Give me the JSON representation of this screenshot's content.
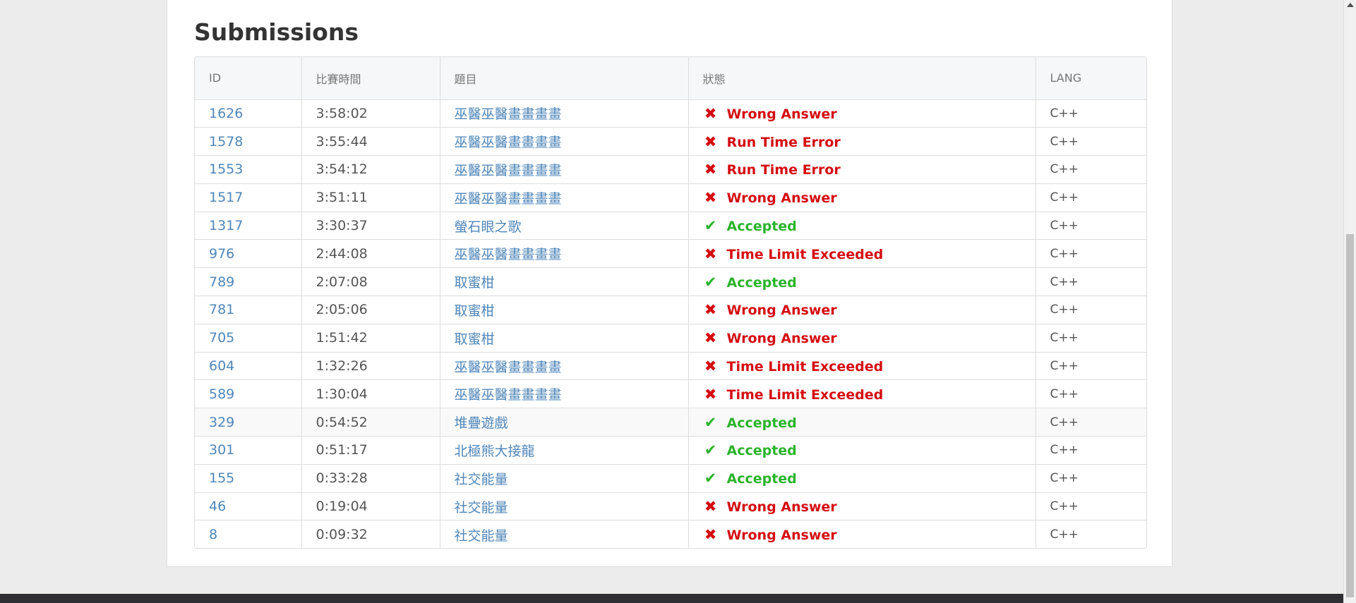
{
  "section_title": "Submissions",
  "table": {
    "headers": {
      "id": "ID",
      "time": "比賽時間",
      "problem": "題目",
      "status": "狀態",
      "lang": "LANG"
    },
    "rows": [
      {
        "id": "1626",
        "time": "3:58:02",
        "problem": "巫醫巫醫畫畫畫畫",
        "status": "Wrong Answer",
        "result": "bad",
        "lang": "C++"
      },
      {
        "id": "1578",
        "time": "3:55:44",
        "problem": "巫醫巫醫畫畫畫畫",
        "status": "Run Time Error",
        "result": "bad",
        "lang": "C++"
      },
      {
        "id": "1553",
        "time": "3:54:12",
        "problem": "巫醫巫醫畫畫畫畫",
        "status": "Run Time Error",
        "result": "bad",
        "lang": "C++"
      },
      {
        "id": "1517",
        "time": "3:51:11",
        "problem": "巫醫巫醫畫畫畫畫",
        "status": "Wrong Answer",
        "result": "bad",
        "lang": "C++"
      },
      {
        "id": "1317",
        "time": "3:30:37",
        "problem": "螢石眼之歌",
        "status": "Accepted",
        "result": "good",
        "lang": "C++"
      },
      {
        "id": "976",
        "time": "2:44:08",
        "problem": "巫醫巫醫畫畫畫畫",
        "status": "Time Limit Exceeded",
        "result": "bad",
        "lang": "C++"
      },
      {
        "id": "789",
        "time": "2:07:08",
        "problem": "取蜜柑",
        "status": "Accepted",
        "result": "good",
        "lang": "C++"
      },
      {
        "id": "781",
        "time": "2:05:06",
        "problem": "取蜜柑",
        "status": "Wrong Answer",
        "result": "bad",
        "lang": "C++"
      },
      {
        "id": "705",
        "time": "1:51:42",
        "problem": "取蜜柑",
        "status": "Wrong Answer",
        "result": "bad",
        "lang": "C++"
      },
      {
        "id": "604",
        "time": "1:32:26",
        "problem": "巫醫巫醫畫畫畫畫",
        "status": "Time Limit Exceeded",
        "result": "bad",
        "lang": "C++"
      },
      {
        "id": "589",
        "time": "1:30:04",
        "problem": "巫醫巫醫畫畫畫畫",
        "status": "Time Limit Exceeded",
        "result": "bad",
        "lang": "C++"
      },
      {
        "id": "329",
        "time": "0:54:52",
        "problem": "堆疊遊戲",
        "status": "Accepted",
        "result": "good",
        "lang": "C++",
        "hover": true
      },
      {
        "id": "301",
        "time": "0:51:17",
        "problem": "北極熊大接龍",
        "status": "Accepted",
        "result": "good",
        "lang": "C++"
      },
      {
        "id": "155",
        "time": "0:33:28",
        "problem": "社交能量",
        "status": "Accepted",
        "result": "good",
        "lang": "C++"
      },
      {
        "id": "46",
        "time": "0:19:04",
        "problem": "社交能量",
        "status": "Wrong Answer",
        "result": "bad",
        "lang": "C++"
      },
      {
        "id": "8",
        "time": "0:09:32",
        "problem": "社交能量",
        "status": "Wrong Answer",
        "result": "bad",
        "lang": "C++"
      }
    ]
  },
  "icons": {
    "bad": {
      "name": "cross-icon",
      "glyph": "✖"
    },
    "good": {
      "name": "check-icon",
      "glyph": "✔"
    }
  },
  "colors": {
    "link": "#4f86b8",
    "bad": "#d40d12",
    "good": "#2cb32c",
    "page_bg": "#ececec",
    "footer": "#2e2e33"
  }
}
